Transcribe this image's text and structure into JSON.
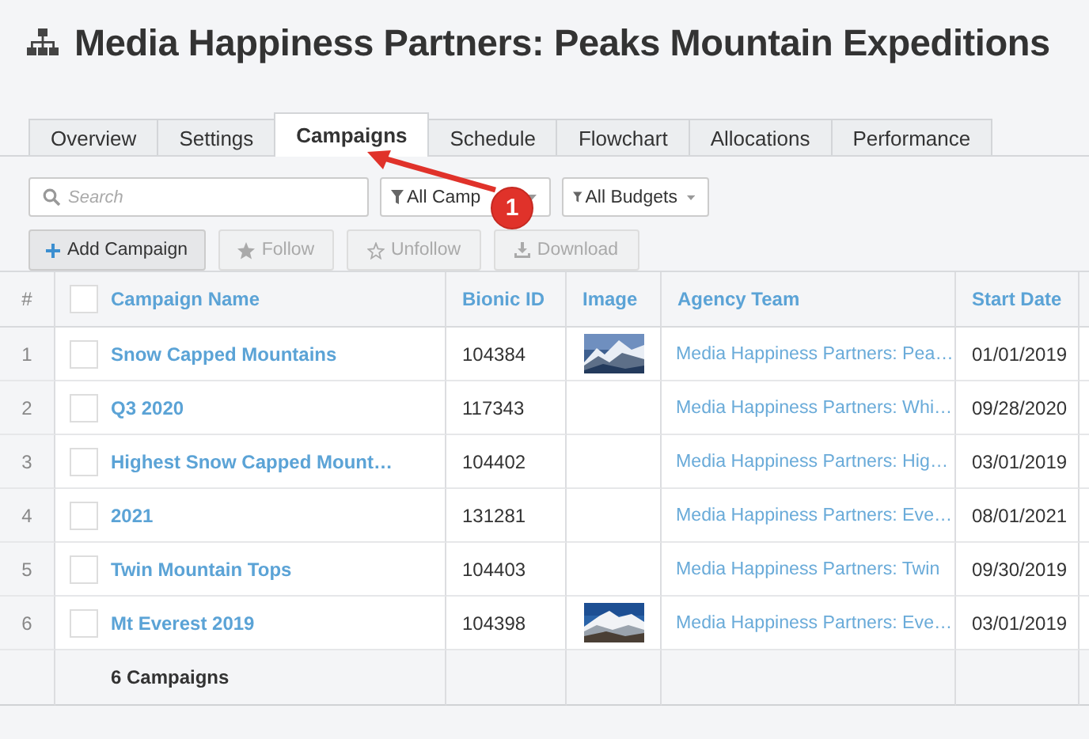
{
  "page": {
    "title": "Media Happiness Partners: Peaks Mountain Expeditions"
  },
  "tabs": [
    {
      "label": "Overview",
      "selected": false
    },
    {
      "label": "Settings",
      "selected": false
    },
    {
      "label": "Campaigns",
      "selected": true
    },
    {
      "label": "Schedule",
      "selected": false
    },
    {
      "label": "Flowchart",
      "selected": false
    },
    {
      "label": "Allocations",
      "selected": false
    },
    {
      "label": "Performance",
      "selected": false
    }
  ],
  "search": {
    "placeholder": "Search"
  },
  "filters": [
    {
      "label": "All Camp"
    },
    {
      "label": "All Budgets"
    }
  ],
  "buttons": [
    {
      "label": "Add Campaign",
      "kind": "add",
      "disabled": false
    },
    {
      "label": "Follow",
      "kind": "follow",
      "disabled": true
    },
    {
      "label": "Unfollow",
      "kind": "unfollow",
      "disabled": true
    },
    {
      "label": "Download",
      "kind": "download",
      "disabled": true
    }
  ],
  "table": {
    "columns": [
      "#",
      "Campaign Name",
      "Bionic ID",
      "Image",
      "Agency Team",
      "Start Date"
    ],
    "select_all_checked": false,
    "rows": [
      {
        "number": "1",
        "checked": false,
        "name": "Snow Capped Mountains",
        "bionic_id": "104384",
        "has_image": true,
        "agency_team": "Media Happiness Partners: Pea…",
        "start_date": "01/01/2019"
      },
      {
        "number": "2",
        "checked": false,
        "name": "Q3 2020",
        "bionic_id": "117343",
        "has_image": false,
        "agency_team": "Media Happiness Partners: Whi…",
        "start_date": "09/28/2020"
      },
      {
        "number": "3",
        "checked": false,
        "name": "Highest Snow Capped Mount…",
        "bionic_id": "104402",
        "has_image": false,
        "agency_team": "Media Happiness Partners: Hig…",
        "start_date": "03/01/2019"
      },
      {
        "number": "4",
        "checked": false,
        "name": "2021",
        "bionic_id": "131281",
        "has_image": false,
        "agency_team": "Media Happiness Partners: Eve…",
        "start_date": "08/01/2021"
      },
      {
        "number": "5",
        "checked": false,
        "name": "Twin Mountain Tops",
        "bionic_id": "104403",
        "has_image": false,
        "agency_team": "Media Happiness Partners: Twin",
        "start_date": "09/30/2019"
      },
      {
        "number": "6",
        "checked": false,
        "name": "Mt Everest 2019",
        "bionic_id": "104398",
        "has_image": true,
        "agency_team": "Media Happiness Partners: Eve…",
        "start_date": "03/01/2019"
      }
    ],
    "footer": "6 Campaigns"
  },
  "callout": {
    "number": "1"
  }
}
